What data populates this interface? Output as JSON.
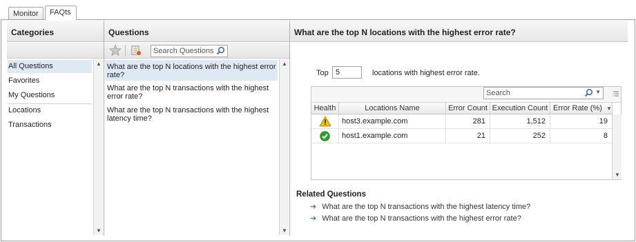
{
  "tabs": [
    {
      "label": "Monitor",
      "active": false
    },
    {
      "label": "FAQts",
      "active": true
    }
  ],
  "categories": {
    "header": "Categories",
    "items": [
      {
        "label": "All Questions",
        "selected": true
      },
      {
        "label": "Favorites",
        "selected": false
      },
      {
        "label": "My Questions",
        "selected": false
      },
      {
        "label": "Locations",
        "selected": false
      },
      {
        "label": "Transactions",
        "selected": false
      }
    ]
  },
  "questions": {
    "header": "Questions",
    "search_placeholder": "Search Questions",
    "items": [
      {
        "line1": "What are the top N locations with the highest error",
        "line2": "rate?",
        "selected": true
      },
      {
        "line1": "What are the top N transactions with the highest",
        "line2": "error rate?",
        "selected": false
      },
      {
        "line1": "What are the top N transactions with the highest",
        "line2": "latency time?",
        "selected": false
      }
    ]
  },
  "detail": {
    "title": "What are the top N locations with the highest error rate?",
    "top_label": "Top",
    "top_value": "5",
    "top_suffix": "locations with highest error rate.",
    "grid": {
      "search_placeholder": "Search",
      "columns": [
        "Health",
        "Locations Name",
        "Error Count",
        "Execution Count",
        "Error Rate (%)"
      ],
      "rows": [
        {
          "health": "warning-icon",
          "name": "host3.example.com",
          "error_count": "281",
          "execution_count": "1,512",
          "error_rate": "19"
        },
        {
          "health": "ok-icon",
          "name": "host1.example.com",
          "error_count": "21",
          "execution_count": "252",
          "error_rate": "8"
        }
      ]
    },
    "related": {
      "title": "Related Questions",
      "items": [
        "What are the top N transactions with the highest latency time?",
        "What are the top N transactions with the highest error rate?"
      ]
    }
  },
  "colors": {
    "selection": "#dde8f6",
    "link_arrow": "#3a78c8",
    "warning": "#f2c200",
    "ok": "#2aa52a"
  }
}
